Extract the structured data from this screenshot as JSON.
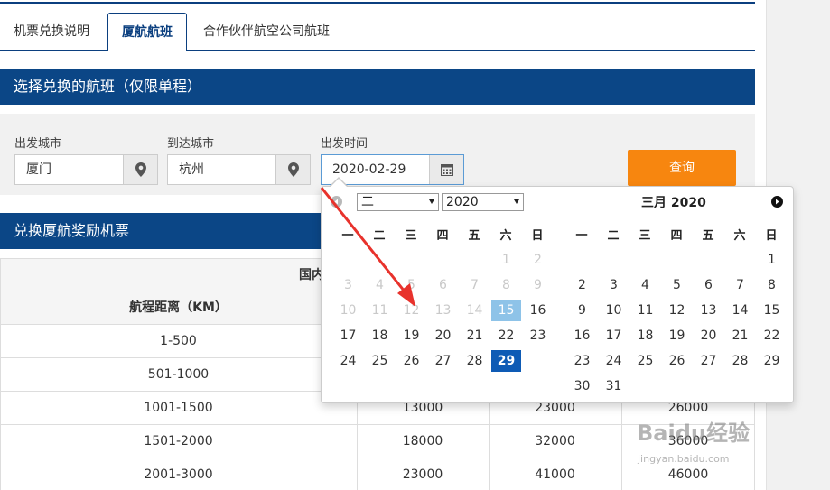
{
  "tabs": [
    {
      "label": "机票兑换说明",
      "active": false
    },
    {
      "label": "厦航航班",
      "active": true
    },
    {
      "label": "合作伙伴航空公司航班",
      "active": false
    }
  ],
  "section1_title": "选择兑换的航班（仅限单程）",
  "form": {
    "from_label": "出发城市",
    "from_value": "厦门",
    "to_label": "到达城市",
    "to_value": "杭州",
    "date_label": "出发时间",
    "date_value": "2020-02-29",
    "query_button": "查询"
  },
  "section2_title": "兑换厦航奖励机票",
  "table": {
    "group_header": "国内",
    "distance_header": "航程距离（KM）",
    "rows": [
      {
        "range": "1-500",
        "c1": "",
        "c2": "",
        "c3": ""
      },
      {
        "range": "501-1000",
        "c1": "",
        "c2": "",
        "c3": ""
      },
      {
        "range": "1001-1500",
        "c1": "13000",
        "c2": "23000",
        "c3": "26000"
      },
      {
        "range": "1501-2000",
        "c1": "18000",
        "c2": "32000",
        "c3": "36000"
      },
      {
        "range": "2001-3000",
        "c1": "23000",
        "c2": "41000",
        "c3": "46000"
      }
    ]
  },
  "datepicker": {
    "month_select": "二",
    "year_select": "2020",
    "right_title": "三月 2020",
    "weekdays": [
      "一",
      "二",
      "三",
      "四",
      "五",
      "六",
      "日"
    ],
    "left_weeks": [
      [
        "",
        "",
        "",
        "",
        "",
        "1",
        "2"
      ],
      [
        "3",
        "4",
        "5",
        "6",
        "7",
        "8",
        "9"
      ],
      [
        "10",
        "11",
        "12",
        "13",
        "14",
        "15",
        "16"
      ],
      [
        "17",
        "18",
        "19",
        "20",
        "21",
        "22",
        "23"
      ],
      [
        "24",
        "25",
        "26",
        "27",
        "28",
        "29",
        ""
      ]
    ],
    "right_weeks": [
      [
        "",
        "",
        "",
        "",
        "",
        "",
        "1"
      ],
      [
        "2",
        "3",
        "4",
        "5",
        "6",
        "7",
        "8"
      ],
      [
        "9",
        "10",
        "11",
        "12",
        "13",
        "14",
        "15"
      ],
      [
        "16",
        "17",
        "18",
        "19",
        "20",
        "21",
        "22"
      ],
      [
        "23",
        "24",
        "25",
        "26",
        "27",
        "28",
        "29"
      ],
      [
        "30",
        "31",
        "",
        "",
        "",
        "",
        ""
      ]
    ],
    "today": "15",
    "selected": "29"
  },
  "watermark": {
    "logo": "Baidu经验",
    "url": "jingyan.baidu.com"
  },
  "colors": {
    "brand_blue": "#0b4686",
    "query_orange": "#f7860f",
    "selected_blue": "#0e5bb5",
    "today_blue": "#8ec3e8",
    "arrow_red": "#e8322c"
  },
  "icons": {
    "location": "map-pin-icon",
    "calendar": "calendar-icon",
    "prev": "prev-month-icon",
    "next": "next-month-icon"
  }
}
